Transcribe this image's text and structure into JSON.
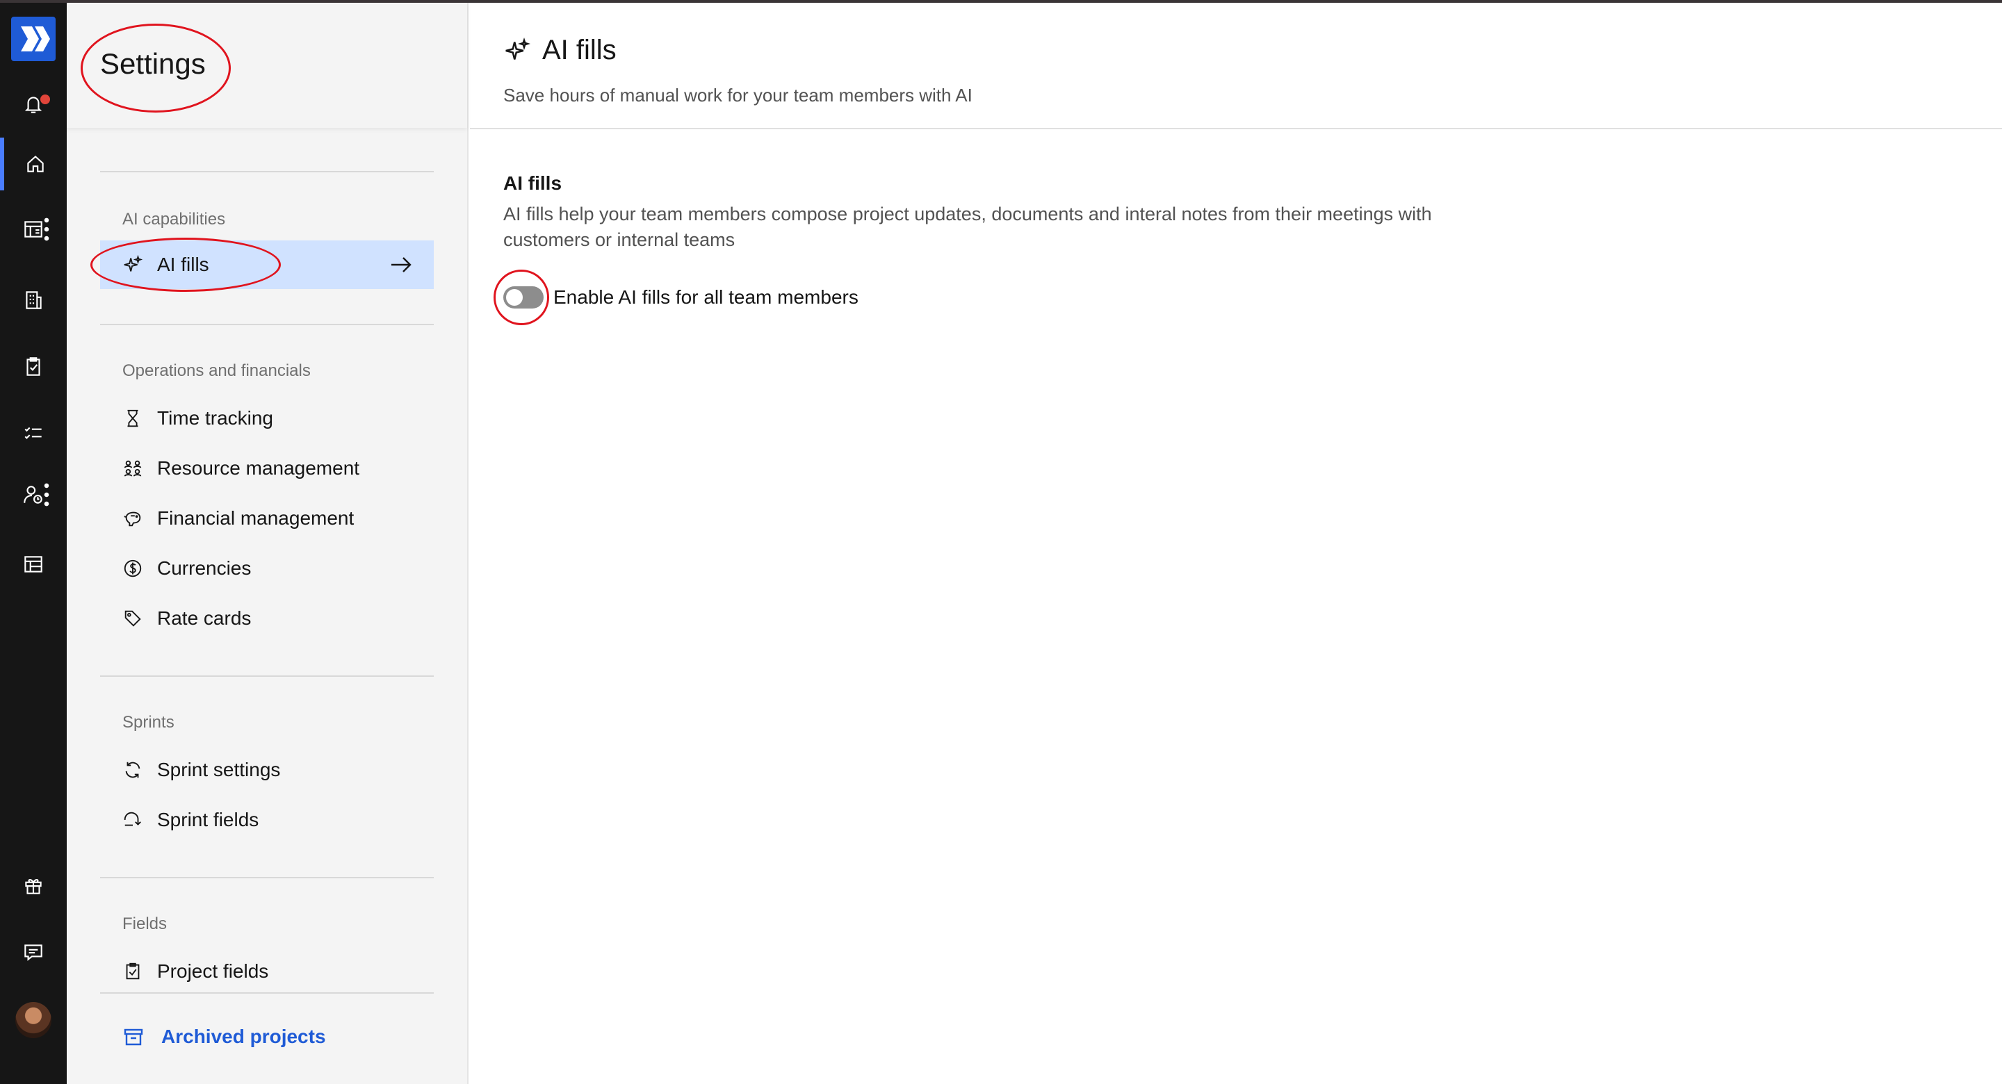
{
  "rail": {
    "items": [
      {
        "icon": "bell-icon"
      },
      {
        "icon": "home-icon"
      },
      {
        "icon": "calendar-grid-icon"
      },
      {
        "icon": "building-icon"
      },
      {
        "icon": "clipboard-check-icon"
      },
      {
        "icon": "checklist-icon"
      },
      {
        "icon": "person-clock-icon"
      },
      {
        "icon": "layout-icon"
      },
      {
        "icon": "gift-icon"
      },
      {
        "icon": "chat-icon"
      }
    ],
    "accent": "#1f5bd6"
  },
  "sidebar": {
    "title": "Settings",
    "groups": [
      {
        "label": "AI capabilities",
        "items": [
          {
            "label": "AI fills",
            "icon": "sparkles-icon",
            "selected": true
          }
        ]
      },
      {
        "label": "Operations and financials",
        "items": [
          {
            "label": "Time tracking",
            "icon": "hourglass-icon"
          },
          {
            "label": "Resource management",
            "icon": "people-icon"
          },
          {
            "label": "Financial management",
            "icon": "piggy-bank-icon"
          },
          {
            "label": "Currencies",
            "icon": "dollar-circle-icon"
          },
          {
            "label": "Rate cards",
            "icon": "tag-icon"
          }
        ]
      },
      {
        "label": "Sprints",
        "items": [
          {
            "label": "Sprint settings",
            "icon": "sprint-cycle-icon"
          },
          {
            "label": "Sprint fields",
            "icon": "sprint-arrow-icon"
          }
        ]
      },
      {
        "label": "Fields",
        "items": [
          {
            "label": "Project fields",
            "icon": "clipboard-check-icon"
          }
        ]
      }
    ],
    "archived": "Archived projects"
  },
  "main": {
    "title": "AI fills",
    "subtitle": "Save hours of manual work for your team members with AI",
    "section_title": "AI fills",
    "section_desc": "AI fills help your team members compose project updates, documents and interal notes from their meetings with customers or internal teams",
    "toggle_label": "Enable AI fills for all team members",
    "toggle_on": false
  }
}
